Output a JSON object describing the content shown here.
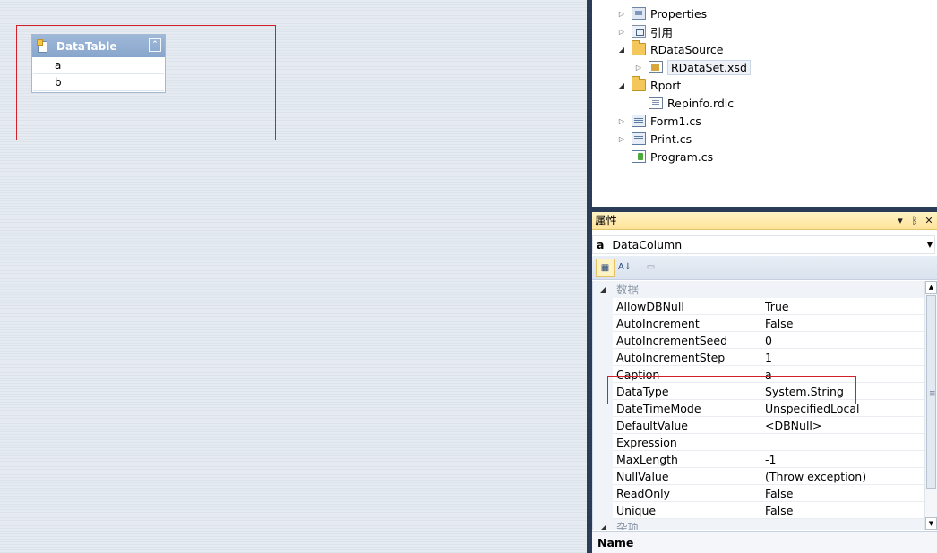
{
  "designer": {
    "datatable": {
      "title": "DataTable",
      "collapse_glyph": "⌃",
      "columns": [
        "a",
        "b"
      ]
    }
  },
  "solution_explorer": {
    "items": [
      {
        "label": "Properties",
        "icon": "properties-icon",
        "expanded": false
      },
      {
        "label": "引用",
        "icon": "references-icon",
        "expanded": false
      },
      {
        "label": "RDataSource",
        "icon": "folder-open-icon",
        "expanded": true
      },
      {
        "label": "RDataSet.xsd",
        "icon": "xsd-file-icon",
        "expanded": false,
        "selected": true
      },
      {
        "label": "Rport",
        "icon": "folder-open-icon",
        "expanded": true
      },
      {
        "label": "Repinfo.rdlc",
        "icon": "rdlc-file-icon"
      },
      {
        "label": "Form1.cs",
        "icon": "form-file-icon",
        "expanded": false
      },
      {
        "label": "Print.cs",
        "icon": "cs-file-icon",
        "expanded": false
      },
      {
        "label": "Program.cs",
        "icon": "cs-program-icon"
      }
    ]
  },
  "properties_panel": {
    "title": "属性",
    "buttons": {
      "dropdown": "▾",
      "pin": "ᛒ",
      "close": "✕"
    },
    "object": {
      "name": "a",
      "type": "DataColumn"
    },
    "toolbar": {
      "categorized": "▦",
      "alphabetical": "A↓",
      "pages": "▭"
    },
    "categories": [
      {
        "name": "数据",
        "properties": [
          {
            "name": "AllowDBNull",
            "value": "True"
          },
          {
            "name": "AutoIncrement",
            "value": "False"
          },
          {
            "name": "AutoIncrementSeed",
            "value": "0"
          },
          {
            "name": "AutoIncrementStep",
            "value": "1"
          },
          {
            "name": "Caption",
            "value": "a"
          },
          {
            "name": "DataType",
            "value": "System.String"
          },
          {
            "name": "DateTimeMode",
            "value": "UnspecifiedLocal"
          },
          {
            "name": "DefaultValue",
            "value": "<DBNull>"
          },
          {
            "name": "Expression",
            "value": ""
          },
          {
            "name": "MaxLength",
            "value": "-1"
          },
          {
            "name": "NullValue",
            "value": "(Throw exception)"
          },
          {
            "name": "ReadOnly",
            "value": "False"
          },
          {
            "name": "Unique",
            "value": "False"
          }
        ]
      },
      {
        "name": "杂项",
        "properties": []
      }
    ],
    "description_title": "Name"
  },
  "colors": {
    "splitter": "#2b3c59",
    "titlebar": "#ffe39a",
    "highlight": "#d0202a",
    "datatable_header": "#9fb8d8"
  }
}
